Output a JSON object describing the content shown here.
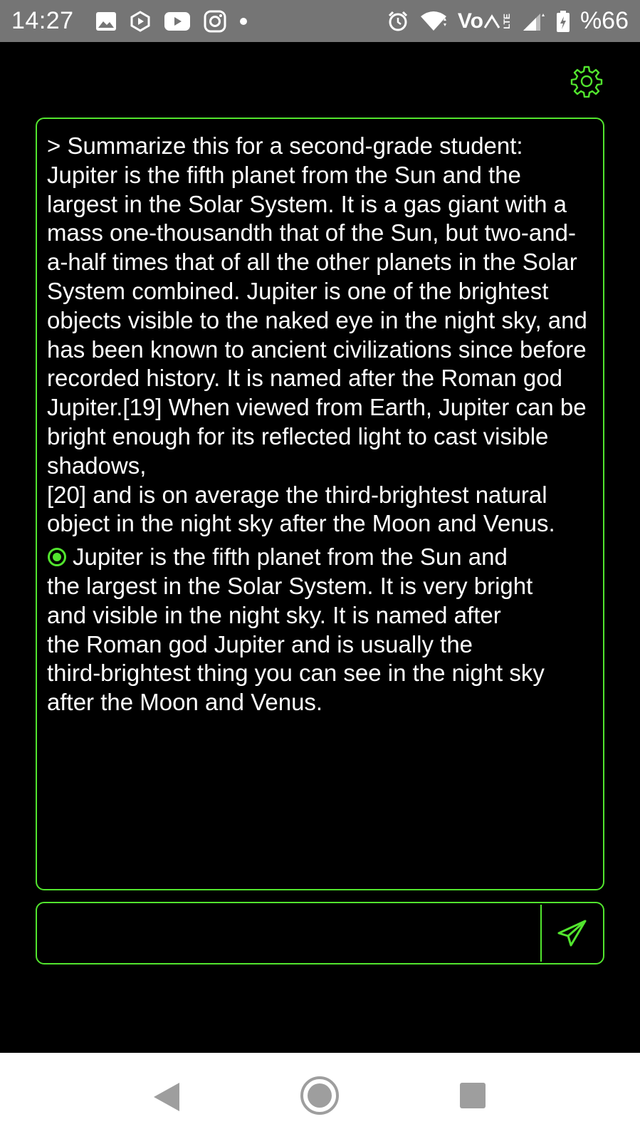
{
  "status_bar": {
    "time": "14:27",
    "battery": "%66",
    "network": "Vo",
    "lte": "LTE",
    "icons": [
      "gallery-icon",
      "shield-play-icon",
      "youtube-icon",
      "instagram-icon",
      "dot-icon",
      "alarm-icon",
      "wifi-icon",
      "volte-icon",
      "signal-icon",
      "battery-icon"
    ]
  },
  "settings": {
    "icon": "gear-icon"
  },
  "conversation": {
    "prompt": "> Summarize this for a second-grade student:\nJupiter is the fifth planet from the Sun and the largest in the Solar System. It is a gas giant with a mass one-thousandth that of the Sun, but two-and-a-half times that of all the other planets in the Solar System combined. Jupiter is one of the brightest objects visible to the naked eye in the night sky, and has been known to ancient civilizations since before recorded history. It is named after the Roman god Jupiter.[19] When viewed from Earth, Jupiter can be bright enough for its reflected light to cast visible shadows,\n[20] and is on average the third-brightest natural object in the night sky after the Moon and Venus.",
    "response": "Jupiter is the fifth planet from the Sun and\nthe largest in the Solar System. It is very bright\nand visible in the night sky. It is named after\nthe Roman god Jupiter and is usually the\nthird-brightest thing you can see in the night sky\nafter the Moon and Venus."
  },
  "input": {
    "value": "",
    "placeholder": ""
  },
  "accent_color": "#52e52e",
  "nav": {
    "icons": [
      "back-icon",
      "home-icon",
      "recents-icon"
    ]
  }
}
